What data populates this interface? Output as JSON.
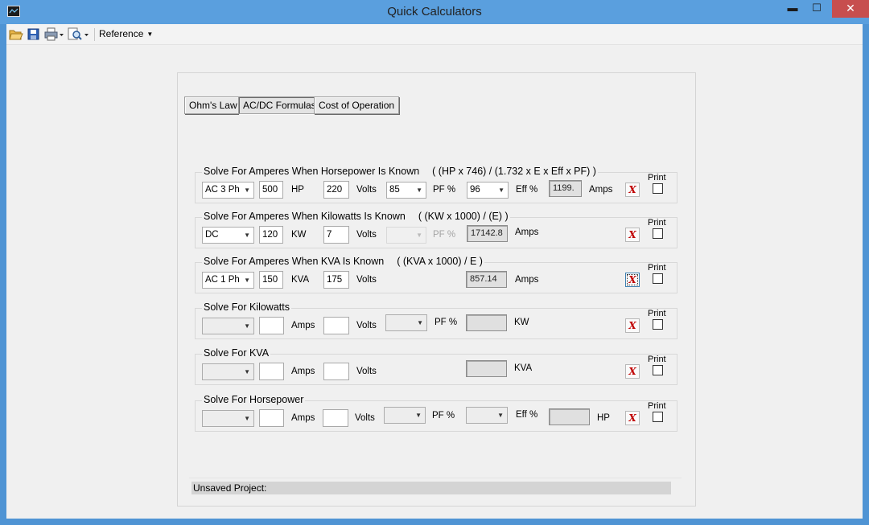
{
  "window": {
    "title": "Quick Calculators",
    "minimize": "▬",
    "maximize": "☐",
    "close": "✕"
  },
  "toolbar": {
    "icons": [
      "open-folder-icon",
      "save-icon",
      "print-icon",
      "print-preview-icon"
    ],
    "reference_label": "Reference"
  },
  "tabs": [
    {
      "label": "Ohm's Law",
      "active": false
    },
    {
      "label": "AC/DC Formulas",
      "active": true
    },
    {
      "label": "Cost of Operation",
      "active": false
    }
  ],
  "groups": {
    "hp_amps": {
      "title": "Solve For Amperes When Horsepower Is Known",
      "formula": "( (HP x 746) / (1.732 x E x Eff x PF) )",
      "phase": "AC 3 Ph",
      "input1": "500",
      "unit1": "HP",
      "volts": "220",
      "volts_label": "Volts",
      "pf": "85",
      "pf_label": "PF %",
      "eff": "96",
      "eff_label": "Eff %",
      "result": "1199.",
      "result_unit": "Amps",
      "clear_label": "X",
      "print_label": "Print"
    },
    "kw_amps": {
      "title": "Solve For Amperes When Kilowatts Is Known",
      "formula": "( (KW x 1000) / (E) )",
      "phase": "DC",
      "input1": "120",
      "unit1": "KW",
      "volts": "7",
      "volts_label": "Volts",
      "pf": "",
      "pf_label": "PF %",
      "result": "17142.8",
      "result_unit": "Amps",
      "clear_label": "X",
      "print_label": "Print"
    },
    "kva_amps": {
      "title": "Solve For Amperes When KVA Is Known",
      "formula": "( (KVA x 1000) / E )",
      "phase": "AC 1 Ph",
      "input1": "150",
      "unit1": "KVA",
      "volts": "175",
      "volts_label": "Volts",
      "result": "857.14",
      "result_unit": "Amps",
      "clear_label": "X",
      "print_label": "Print"
    },
    "kilowatts": {
      "title": "Solve For Kilowatts",
      "phase": "",
      "input1": "",
      "unit1": "Amps",
      "volts": "",
      "volts_label": "Volts",
      "pf": "",
      "pf_label": "PF %",
      "result": "",
      "result_unit": "KW",
      "clear_label": "X",
      "print_label": "Print"
    },
    "kva": {
      "title": "Solve For KVA",
      "phase": "",
      "input1": "",
      "unit1": "Amps",
      "volts": "",
      "volts_label": "Volts",
      "result": "",
      "result_unit": "KVA",
      "clear_label": "X",
      "print_label": "Print"
    },
    "horsepower": {
      "title": "Solve For Horsepower",
      "phase": "",
      "input1": "",
      "unit1": "Amps",
      "volts": "",
      "volts_label": "Volts",
      "pf": "",
      "pf_label": "PF %",
      "eff": "",
      "eff_label": "Eff %",
      "result": "",
      "result_unit": "HP",
      "clear_label": "X",
      "print_label": "Print"
    }
  },
  "status": "Unsaved Project:"
}
